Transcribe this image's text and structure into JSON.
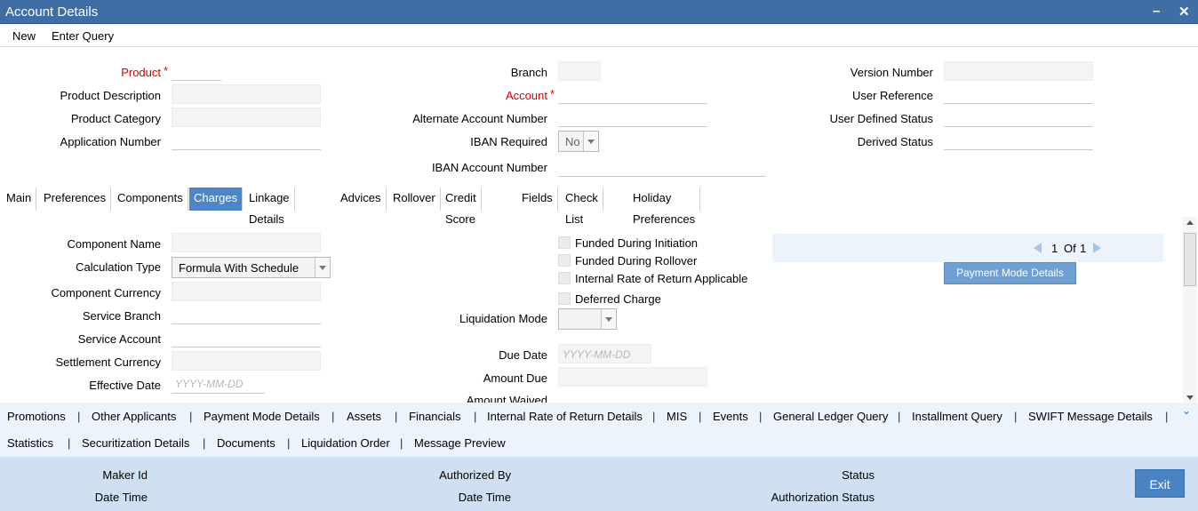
{
  "window": {
    "title": "Account Details",
    "minimize": "–",
    "close": "✕"
  },
  "toolbar": {
    "new": "New",
    "enter_query": "Enter Query"
  },
  "header": {
    "product_label": "Product",
    "product_description_label": "Product Description",
    "product_category_label": "Product Category",
    "application_number_label": "Application Number",
    "branch_label": "Branch",
    "account_label": "Account",
    "alternate_account_label": "Alternate Account Number",
    "iban_required_label": "IBAN Required",
    "iban_required_value": "No",
    "iban_account_label": "IBAN Account Number",
    "version_number_label": "Version Number",
    "user_reference_label": "User Reference",
    "user_defined_status_label": "User Defined Status",
    "derived_status_label": "Derived Status",
    "required_marker": "*"
  },
  "tabs": [
    {
      "label": "Main"
    },
    {
      "label": "Preferences"
    },
    {
      "label": "Components"
    },
    {
      "label": "Charges",
      "active": true
    },
    {
      "label": "Linkage Details"
    },
    {
      "label": "Advices"
    },
    {
      "label": "Rollover"
    },
    {
      "label": "Credit Score"
    },
    {
      "label": "Fields"
    },
    {
      "label": "Check List"
    },
    {
      "label": "Holiday Preferences"
    }
  ],
  "charges": {
    "component_name_label": "Component Name",
    "calculation_type_label": "Calculation Type",
    "calculation_type_value": "Formula With Schedule",
    "component_currency_label": "Component Currency",
    "service_branch_label": "Service Branch",
    "service_account_label": "Service Account",
    "settlement_currency_label": "Settlement Currency",
    "effective_date_label": "Effective Date",
    "date_placeholder": "YYYY-MM-DD",
    "funded_initiation": "Funded During Initiation",
    "funded_rollover": "Funded During Rollover",
    "irr_applicable": "Internal Rate of Return Applicable",
    "deferred_charge": "Deferred Charge",
    "liquidation_mode_label": "Liquidation Mode",
    "due_date_label": "Due Date",
    "amount_due_label": "Amount Due",
    "amount_waived_label": "Amount Waived",
    "pager_current": "1",
    "pager_of": "Of",
    "pager_total": "1",
    "payment_mode_button": "Payment Mode Details"
  },
  "subscreens": {
    "row1": [
      "Promotions",
      "Other Applicants",
      "Payment Mode Details",
      "Assets",
      "Financials",
      "Internal Rate of Return Details",
      "MIS",
      "Events",
      "General Ledger Query",
      "Installment Query",
      "SWIFT Message Details"
    ],
    "row2": [
      "Statistics",
      "Securitization Details",
      "Documents",
      "Liquidation Order",
      "Message Preview"
    ],
    "separator": "|"
  },
  "footer": {
    "maker_id": "Maker Id",
    "date_time": "Date Time",
    "authorized_by": "Authorized By",
    "status": "Status",
    "authorization_status": "Authorization Status",
    "exit": "Exit"
  }
}
